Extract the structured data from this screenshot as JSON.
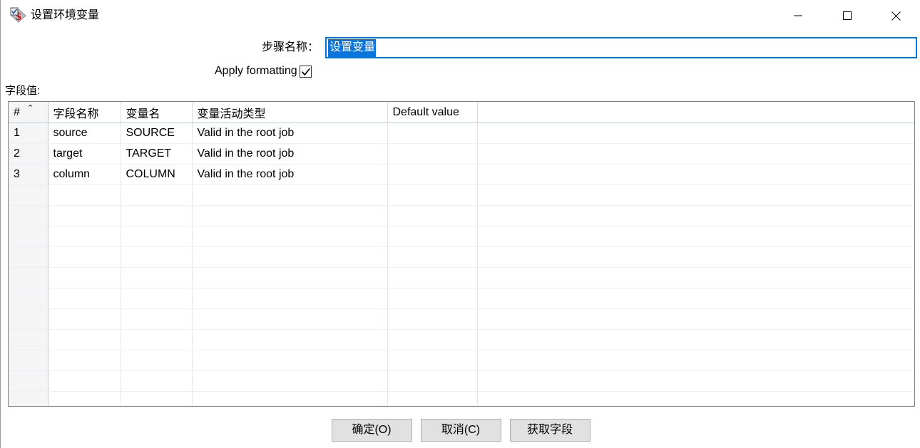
{
  "window": {
    "title": "设置环境变量",
    "icon": "set-variables-icon",
    "controls": {
      "minimize": "minimize-icon",
      "maximize": "maximize-icon",
      "close": "close-icon"
    }
  },
  "form": {
    "step_name_label": "步骤名称：",
    "step_name_value": "设置变量",
    "step_name_placeholder": "",
    "apply_formatting_label": "Apply formatting",
    "apply_formatting_checked": "true"
  },
  "fields_section": {
    "label": "字段值:",
    "sort_indicator": "⌃",
    "columns": [
      "#",
      "字段名称",
      "变量名",
      "变量活动类型",
      "Default value",
      ""
    ],
    "rows": [
      {
        "num": "1",
        "field_name": "source",
        "variable_name": "SOURCE",
        "variable_scope": "Valid in the root job",
        "default_value": "",
        "extra": ""
      },
      {
        "num": "2",
        "field_name": "target",
        "variable_name": "TARGET",
        "variable_scope": "Valid in the root job",
        "default_value": "",
        "extra": ""
      },
      {
        "num": "3",
        "field_name": "column",
        "variable_name": "COLUMN",
        "variable_scope": "Valid in the root job",
        "default_value": "",
        "extra": ""
      }
    ],
    "empty_row_count": 11
  },
  "buttons": {
    "ok": "确定(O)",
    "cancel": "取消(C)",
    "get_fields": "获取字段"
  },
  "colors": {
    "accent": "#0078d7",
    "selection": "#0a74da",
    "button_face": "#e1e1e1",
    "grid_border": "#7a7f86",
    "row_header_bg": "#f5f5f5"
  }
}
